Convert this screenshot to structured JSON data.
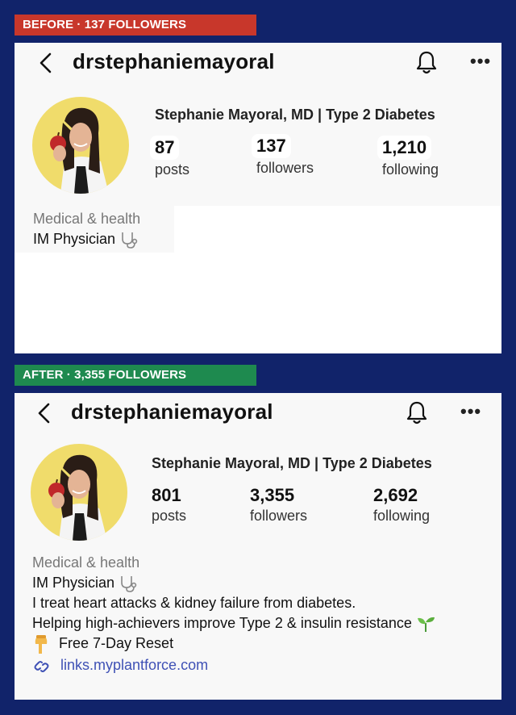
{
  "before": {
    "badge": "BEFORE · 137 FOLLOWERS",
    "handle": "drstephaniemayoral",
    "name": "Stephanie Mayoral, MD | Type 2 Diabetes",
    "stats": [
      {
        "num": "87",
        "label": "posts"
      },
      {
        "num": "137",
        "label": "followers"
      },
      {
        "num": "1,210",
        "label": "following"
      }
    ],
    "category": "Medical & health",
    "bio_line1": "IM Physician"
  },
  "after": {
    "badge": "AFTER · 3,355 FOLLOWERS",
    "handle": "drstephaniemayoral",
    "name": "Stephanie Mayoral, MD | Type 2 Diabetes",
    "stats": [
      {
        "num": "801",
        "label": "posts"
      },
      {
        "num": "3,355",
        "label": "followers"
      },
      {
        "num": "2,692",
        "label": "following"
      }
    ],
    "category": "Medical & health",
    "bio_line1": "IM Physician",
    "bio_line2": "I treat heart attacks & kidney failure from diabetes.",
    "bio_line3": "Helping high-achievers improve Type 2 & insulin resistance",
    "bio_line4": "Free 7-Day Reset",
    "link": "links.myplantforce.com"
  },
  "icons": {
    "back": "chevron-left-icon",
    "bell": "bell-icon",
    "more": "more-horizontal-icon",
    "stethoscope": "stethoscope-icon",
    "seedling": "seedling-icon",
    "pointing": "pointing-down-icon",
    "link": "link-icon"
  },
  "colors": {
    "background": "#11236a",
    "before_badge": "#c8372b",
    "after_badge": "#1e8a4f",
    "link": "#3f51b5",
    "avatar_bg": "#f0dc6b"
  }
}
